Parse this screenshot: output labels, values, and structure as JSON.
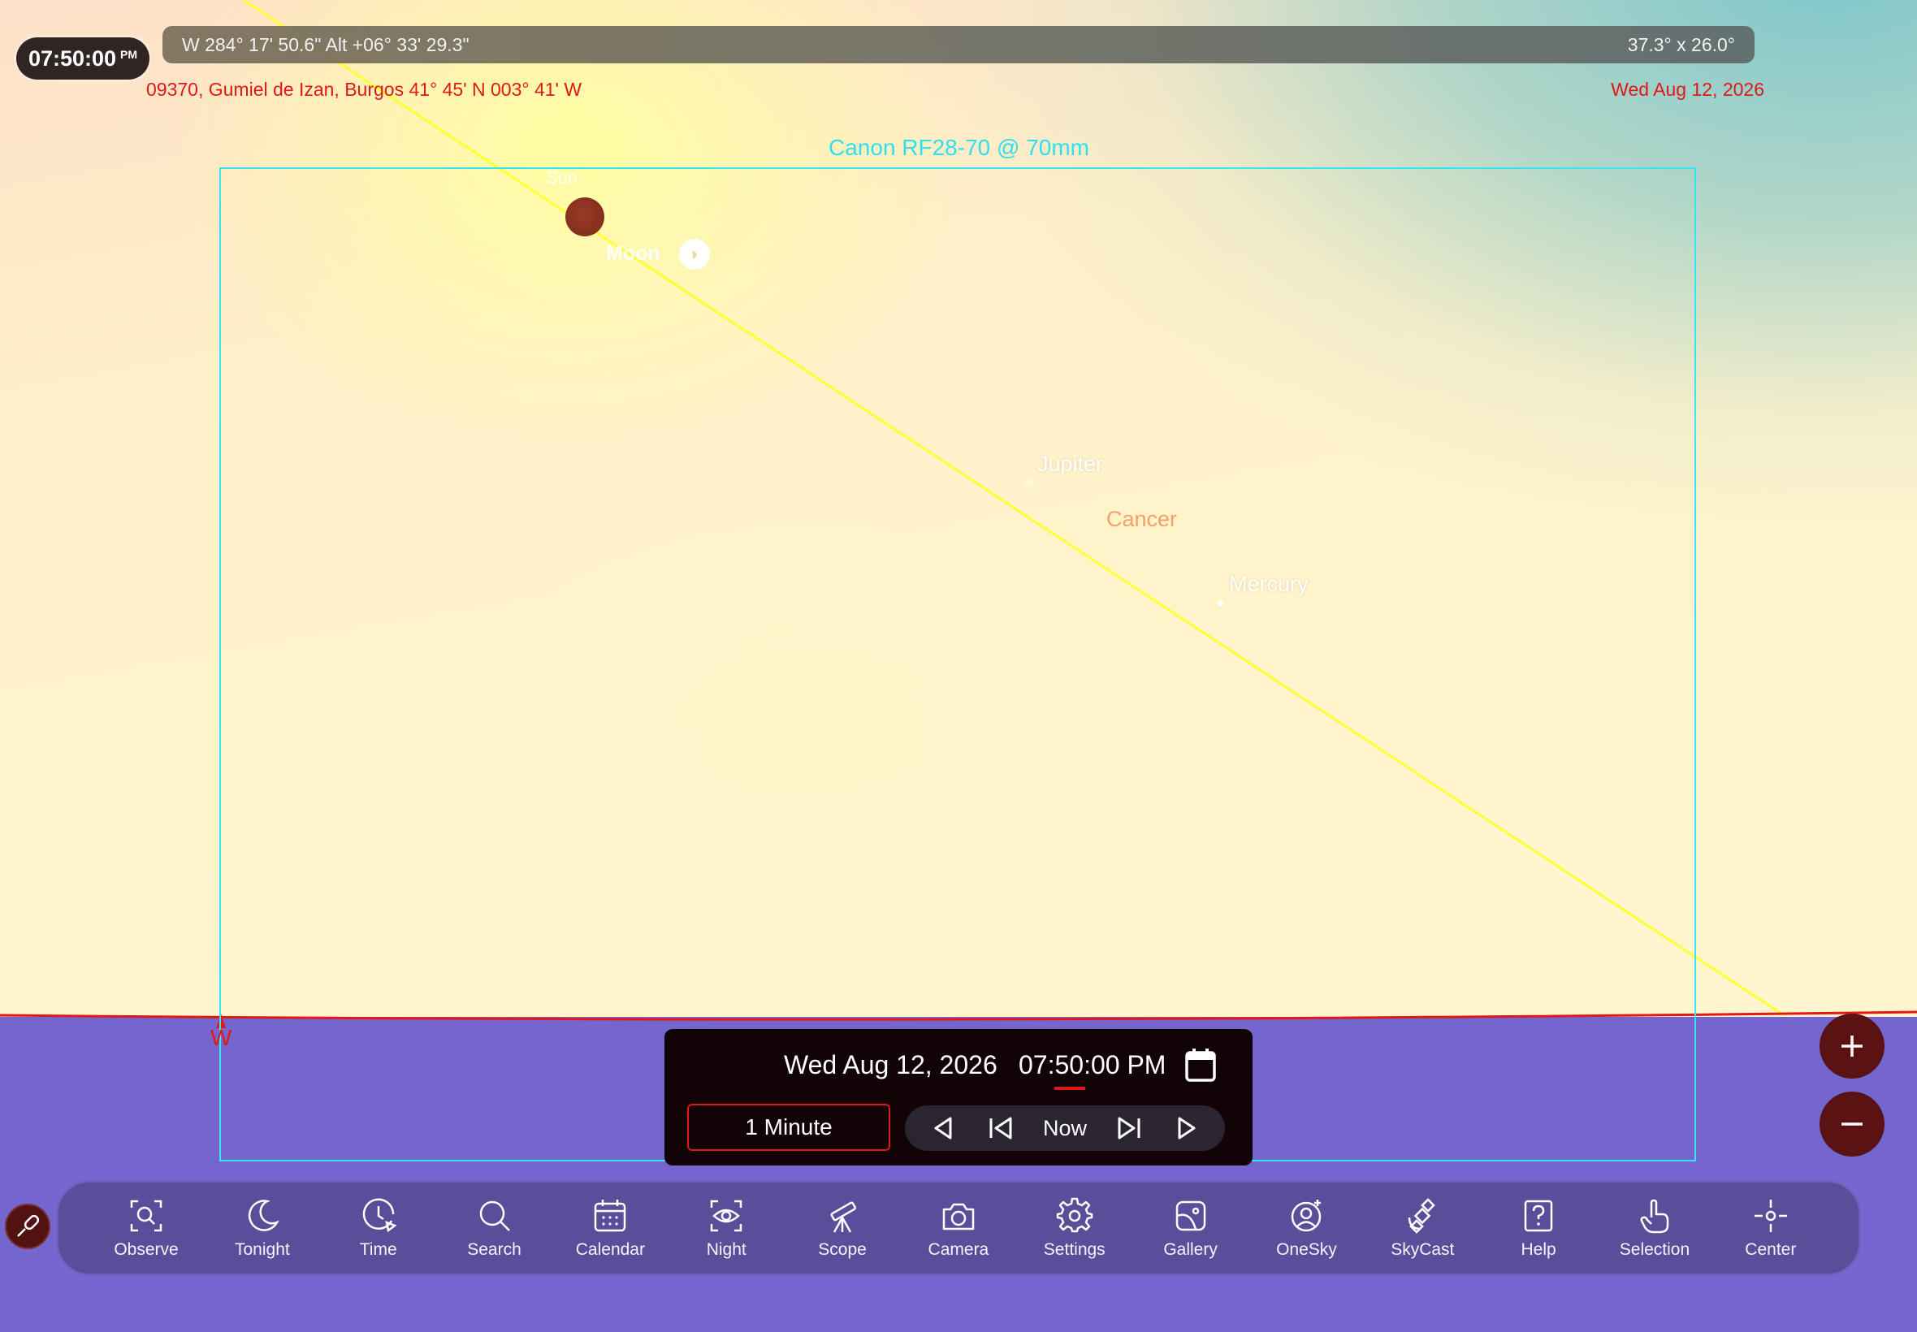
{
  "header": {
    "clock_time": "07:50:00",
    "clock_ampm": "PM",
    "pointing": "W 284° 17' 50.6\" Alt +06° 33' 29.3\"",
    "field_of_view": "37.3° x 26.0°",
    "location": "09370, Gumiel de Izan, Burgos  41° 45' N 003° 41' W",
    "date": "Wed Aug 12, 2026"
  },
  "sky": {
    "camera_frame_label": "Canon RF28-70 @ 70mm",
    "objects": {
      "sun": "Sun",
      "moon": "Moon",
      "jupiter": "Jupiter",
      "mercury": "Mercury",
      "constellation": "Cancer"
    },
    "compass": "W",
    "colors": {
      "horizon_line": "#e01818",
      "ecliptic": "#ffff33",
      "frame": "#37e6f3",
      "ground": "#7565cf"
    }
  },
  "time_panel": {
    "date": "Wed Aug 12, 2026",
    "time": "07:50:00 PM",
    "step": "1 Minute",
    "now_label": "Now"
  },
  "toolbar": {
    "items": [
      {
        "label": "Observe",
        "icon": "observe-icon"
      },
      {
        "label": "Tonight",
        "icon": "moon-icon"
      },
      {
        "label": "Time",
        "icon": "clock-icon"
      },
      {
        "label": "Search",
        "icon": "search-icon"
      },
      {
        "label": "Calendar",
        "icon": "calendar-icon"
      },
      {
        "label": "Night",
        "icon": "eye-icon"
      },
      {
        "label": "Scope",
        "icon": "telescope-icon"
      },
      {
        "label": "Camera",
        "icon": "camera-icon"
      },
      {
        "label": "Settings",
        "icon": "gear-icon"
      },
      {
        "label": "Gallery",
        "icon": "gallery-icon"
      },
      {
        "label": "OneSky",
        "icon": "onesky-icon"
      },
      {
        "label": "SkyCast",
        "icon": "satellite-icon"
      },
      {
        "label": "Help",
        "icon": "help-icon"
      },
      {
        "label": "Selection",
        "icon": "hand-pointer-icon"
      },
      {
        "label": "Center",
        "icon": "crosshair-icon"
      }
    ]
  }
}
